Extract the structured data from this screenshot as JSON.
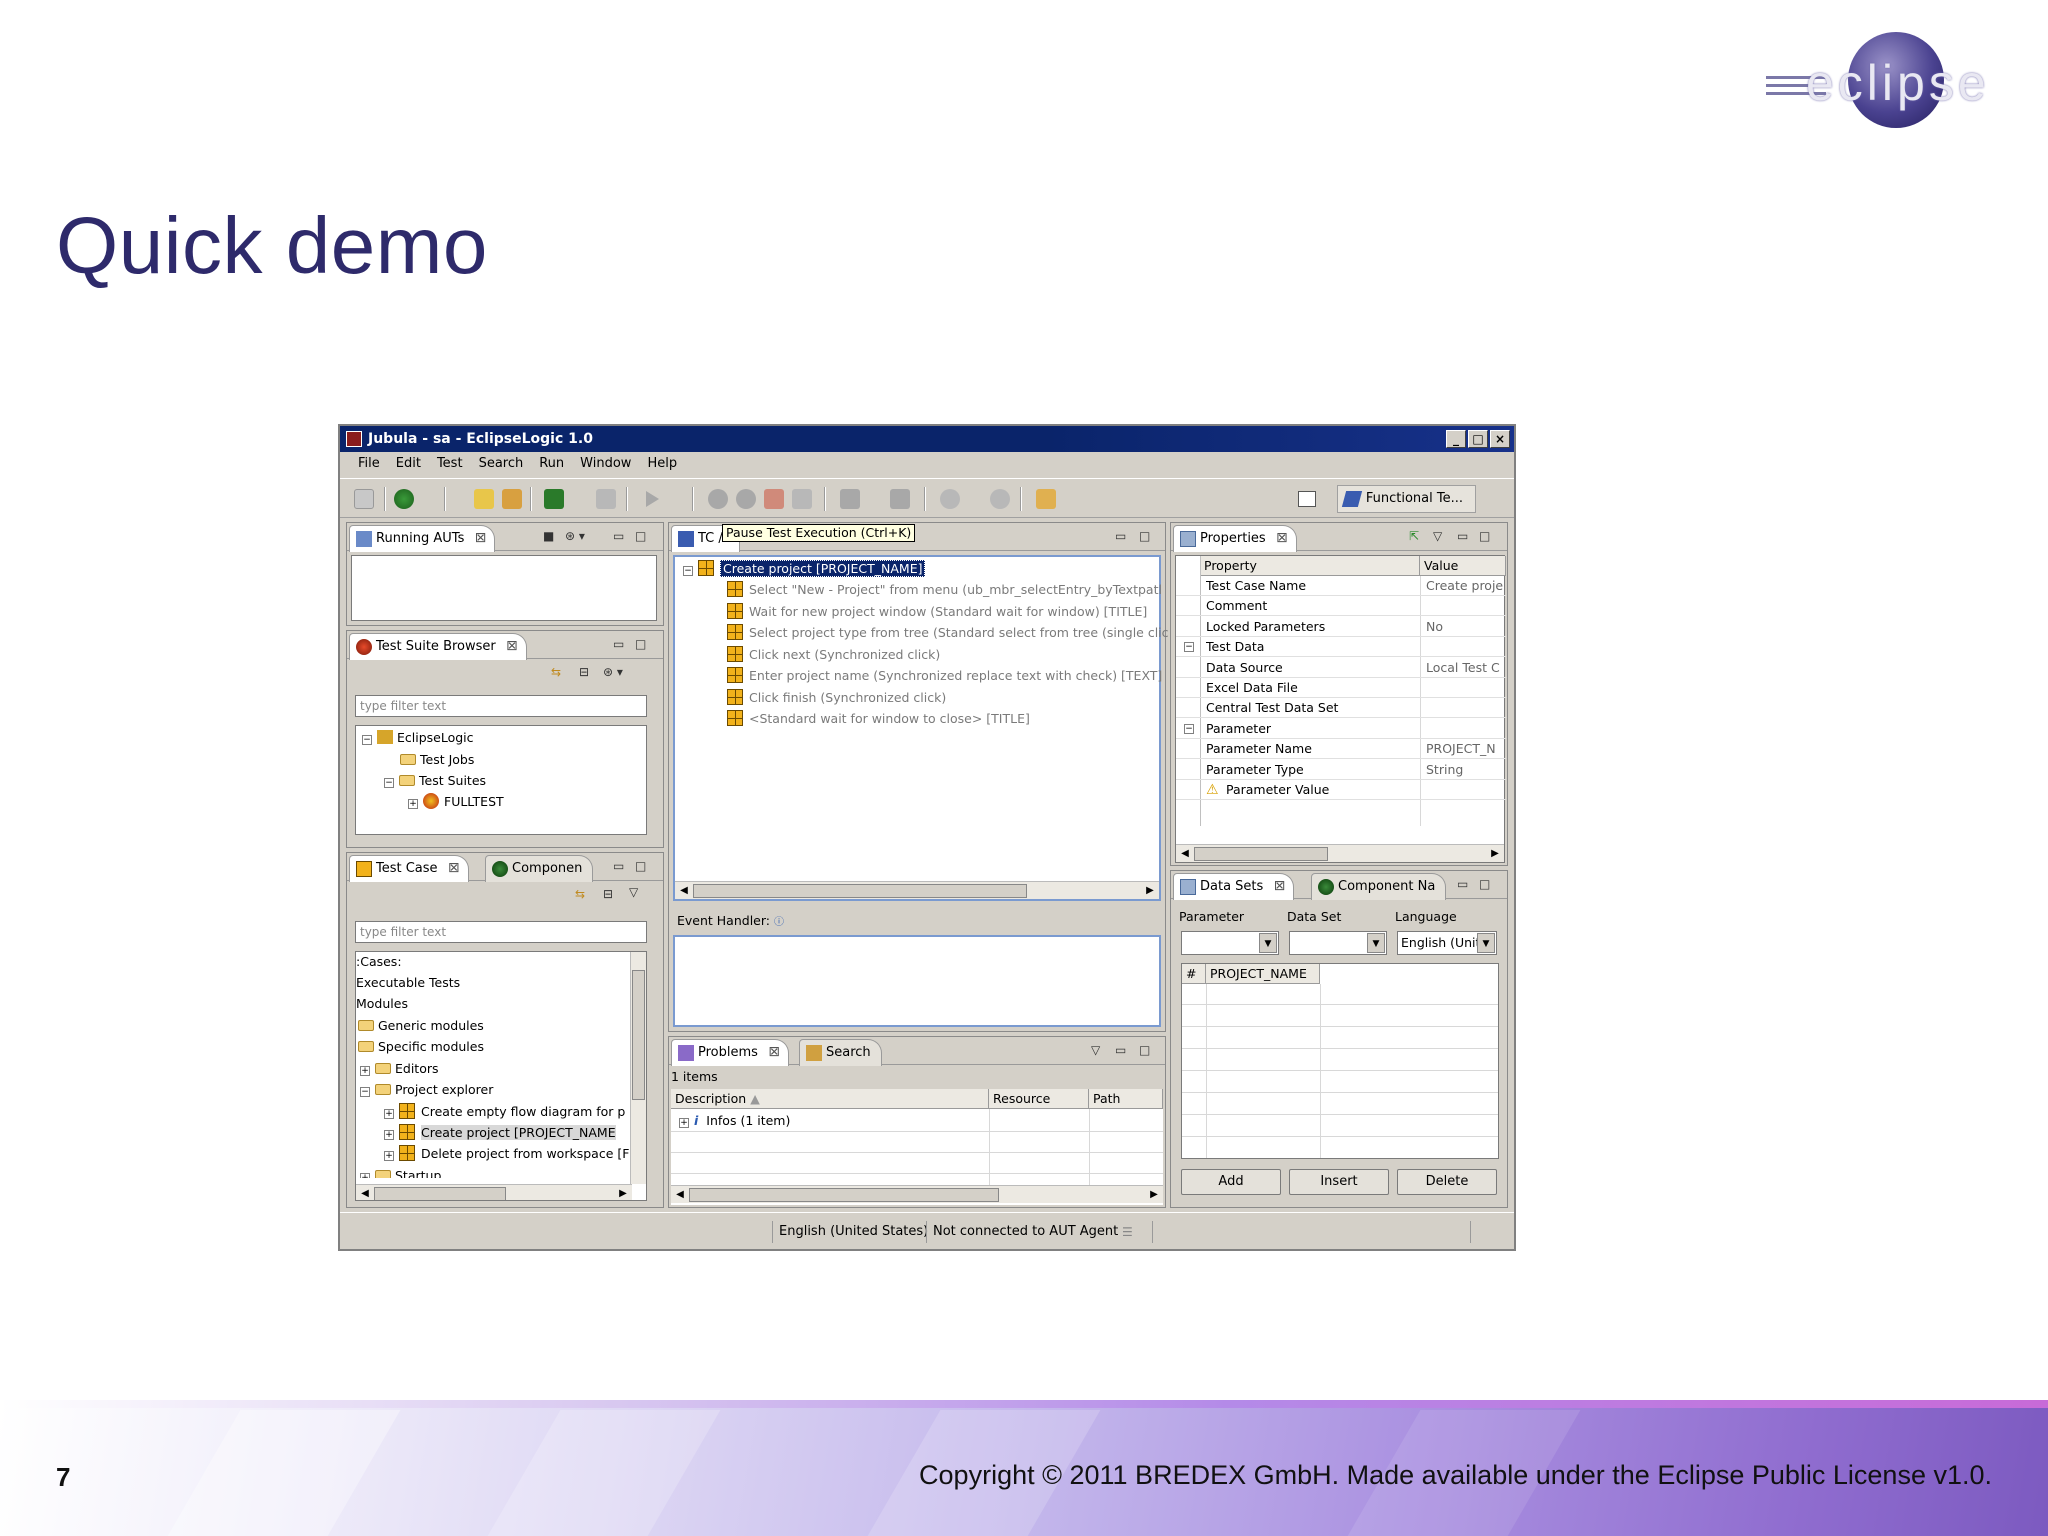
{
  "slide": {
    "title": "Quick demo",
    "page_number": "7",
    "copyright": "Copyright © 2011 BREDEX GmbH. Made available under the Eclipse Public License v1.0.",
    "logo_text": "eclipse"
  },
  "app": {
    "window_title": "Jubula - sa - EclipseLogic 1.0",
    "window_buttons": [
      "_",
      "□",
      "×"
    ],
    "menu": [
      "File",
      "Edit",
      "Test",
      "Search",
      "Run",
      "Window",
      "Help"
    ],
    "perspective_label": "Functional Te...",
    "tooltip": "Pause Test Execution (Ctrl+K)",
    "running_auts": {
      "tab": "Running AUTs"
    },
    "test_suite_browser": {
      "tab": "Test Suite Browser",
      "filter_placeholder": "type filter text",
      "tree": [
        "EclipseLogic",
        "Test Jobs",
        "Test Suites",
        "FULLTEST"
      ]
    },
    "test_case_browser": {
      "tab": "Test Case",
      "tab2": "Componen",
      "filter_placeholder": "type filter text",
      "tree": [
        ":Cases:",
        "Executable Tests",
        "Modules",
        "Generic modules",
        "Specific modules",
        "Editors",
        "Project explorer",
        "Create empty flow diagram for p",
        "Create project [PROJECT_NAME",
        "Delete project from workspace [F",
        "Startup"
      ]
    },
    "tc_editor": {
      "tab": "TC /",
      "root": "Create project [PROJECT_NAME]",
      "steps": [
        "Select \"New - Project\" from menu (ub_mbr_selectEntry_byTextpatl",
        "Wait for new project window (Standard wait for window) [TITLE]",
        "Select project type from tree (Standard select from tree (single clic",
        "Click next (Synchronized click)",
        "Enter project name (Synchronized replace text with check) [TEXT]",
        "Click finish (Synchronized click)",
        "<Standard wait for window to close> [TITLE]"
      ],
      "event_handler_label": "Event Handler:"
    },
    "problems": {
      "tab": "Problems",
      "tab2": "Search",
      "count": "1 items",
      "columns": [
        "Description",
        "Resource",
        "Path"
      ],
      "rows": [
        [
          "Infos (1 item)",
          "",
          ""
        ]
      ]
    },
    "properties": {
      "tab": "Properties",
      "columns": [
        "Property",
        "Value"
      ],
      "rows": [
        {
          "name": "Test Case Name",
          "value": "Create proje"
        },
        {
          "name": "Comment",
          "value": ""
        },
        {
          "name": "Locked Parameters",
          "value": "No"
        },
        {
          "name": "Test Data",
          "value": ""
        },
        {
          "name": "Data Source",
          "value": "Local Test C"
        },
        {
          "name": "Excel Data File",
          "value": ""
        },
        {
          "name": "Central Test Data Set",
          "value": ""
        },
        {
          "name": "Parameter",
          "value": ""
        },
        {
          "name": "Parameter Name",
          "value": "PROJECT_N"
        },
        {
          "name": "Parameter Type",
          "value": "String"
        },
        {
          "name": "Parameter Value",
          "value": ""
        }
      ]
    },
    "data_sets": {
      "tab": "Data Sets",
      "tab2": "Component Na",
      "labels": [
        "Parameter",
        "Data Set",
        "Language"
      ],
      "language_value": "English (Unit",
      "columns": [
        "#",
        "PROJECT_NAME"
      ],
      "buttons": [
        "Add",
        "Insert",
        "Delete"
      ]
    },
    "status": {
      "locale": "English (United States)",
      "connection": "Not connected to AUT Agent"
    }
  }
}
